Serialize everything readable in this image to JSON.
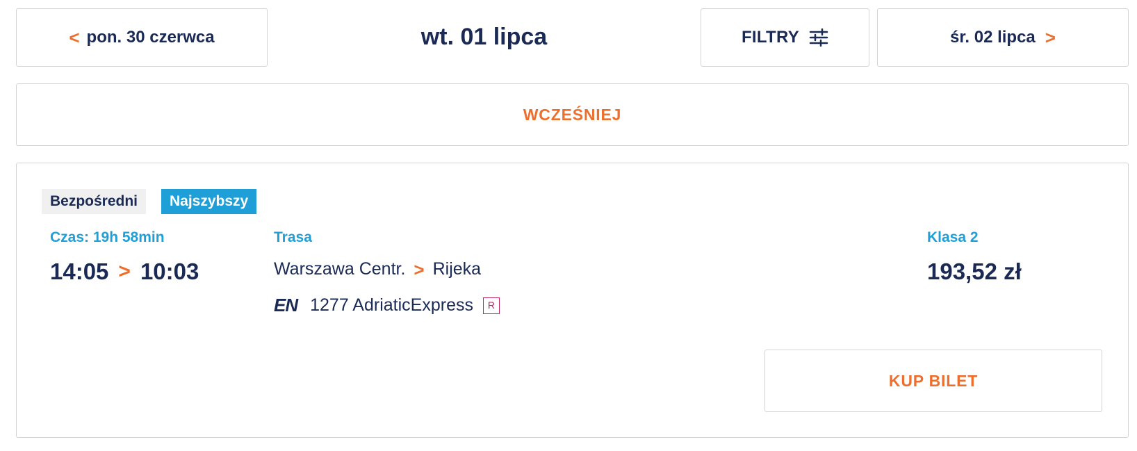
{
  "nav": {
    "prev_date": "pon. 30 czerwca",
    "current_date": "wt. 01 lipca",
    "filter_label": "FILTRY",
    "next_date": "śr. 02 lipca"
  },
  "earlier_label": "WCZEŚNIEJ",
  "result": {
    "badges": {
      "direct": "Bezpośredni",
      "fastest": "Najszybszy"
    },
    "duration_label": "Czas: 19h 58min",
    "departure": "14:05",
    "arrival": "10:03",
    "route_label": "Trasa",
    "from": "Warszawa Centr.",
    "to": "Rijeka",
    "carrier_logo": "EN",
    "train": "1277 AdriaticExpress",
    "reservation_mark": "R",
    "class_label": "Klasa 2",
    "price": "193,52 zł",
    "buy_label": "KUP BILET"
  },
  "icons": {
    "prev": "chevron-left-icon",
    "next": "chevron-right-icon",
    "filter": "sliders-icon",
    "arrow": "chevron-right-icon"
  },
  "colors": {
    "accent": "#ee6f2d",
    "primary": "#1b2a55",
    "info": "#1f9fd8",
    "reservation": "#c0245c",
    "badge_bg": "#f0f0f0"
  }
}
